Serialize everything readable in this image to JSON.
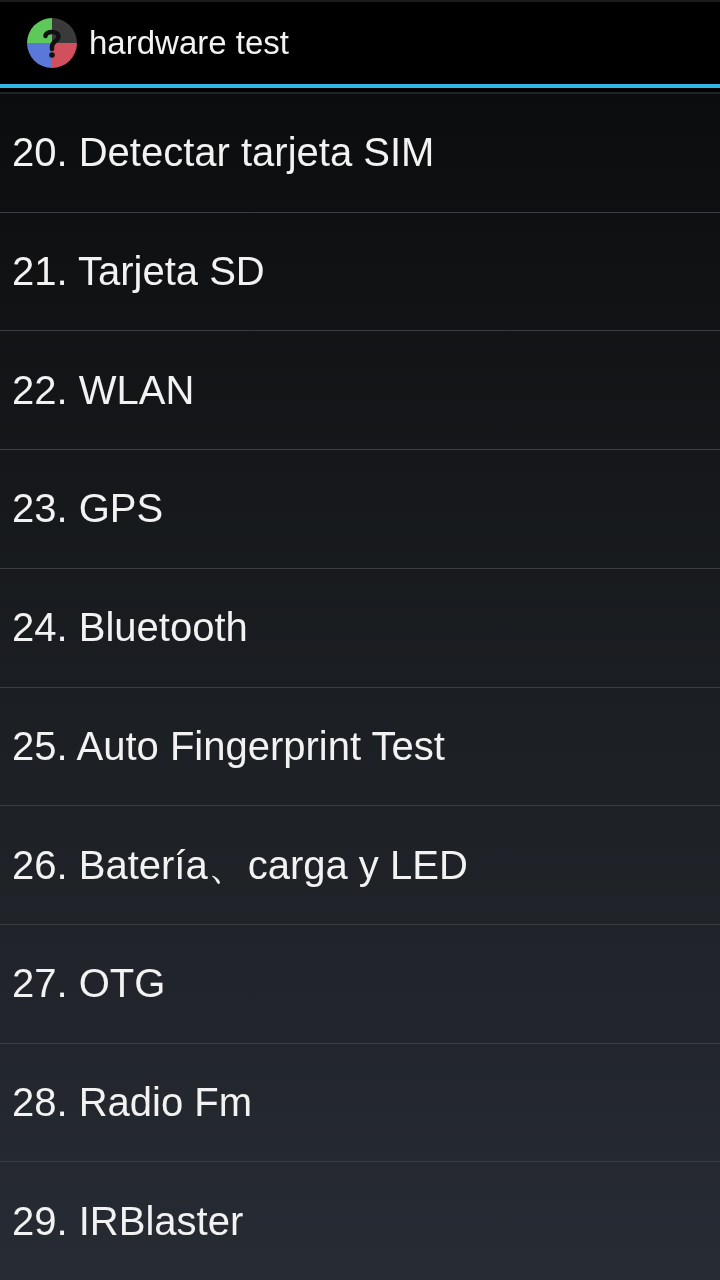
{
  "action_bar": {
    "title": "hardware test"
  },
  "items": [
    {
      "label": "20. Detectar tarjeta SIM"
    },
    {
      "label": "21. Tarjeta SD"
    },
    {
      "label": "22. WLAN"
    },
    {
      "label": "23. GPS"
    },
    {
      "label": "24. Bluetooth"
    },
    {
      "label": "25. Auto Fingerprint Test"
    },
    {
      "label": "26. Batería、carga y LED"
    },
    {
      "label": "27. OTG"
    },
    {
      "label": "28. Radio Fm"
    },
    {
      "label": "29. IRBlaster"
    }
  ]
}
